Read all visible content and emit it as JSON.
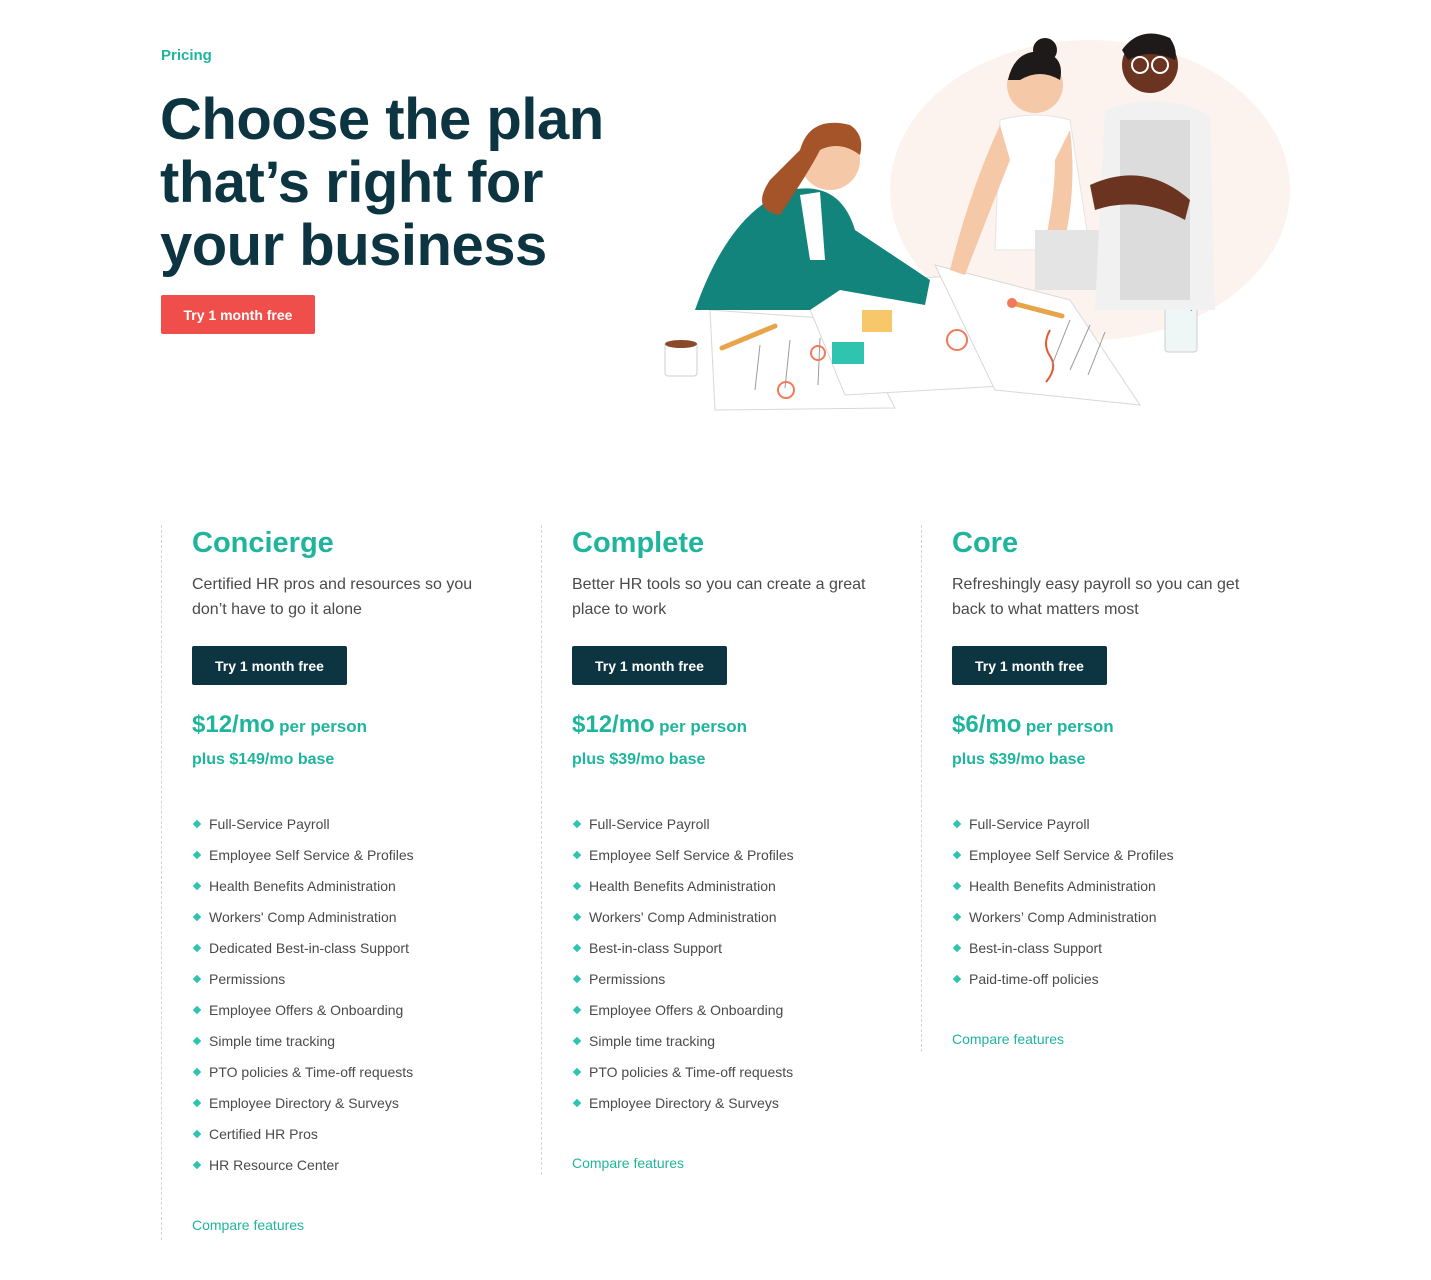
{
  "hero": {
    "eyebrow": "Pricing",
    "headline": "Choose the plan that’s right for your business",
    "cta_label": "Try 1 month free"
  },
  "plans": [
    {
      "name": "Concierge",
      "description": "Certified HR pros and resources so you don’t have to go it alone",
      "cta_label": "Try 1 month free",
      "price": "$12/mo",
      "price_unit": "per person",
      "base": "plus $149/mo base",
      "features": [
        "Full-Service Payroll",
        "Employee Self Service & Profiles",
        "Health Benefits Administration",
        "Workers' Comp Administration",
        "Dedicated Best-in-class Support",
        "Permissions",
        "Employee Offers & Onboarding",
        "Simple time tracking",
        "PTO policies & Time-off requests",
        "Employee Directory & Surveys",
        "Certified HR Pros",
        "HR Resource Center"
      ],
      "compare_label": "Compare features"
    },
    {
      "name": "Complete",
      "description": "Better HR tools so you can create a great place to work",
      "cta_label": "Try 1 month free",
      "price": "$12/mo",
      "price_unit": "per person",
      "base": "plus $39/mo base",
      "features": [
        "Full-Service Payroll",
        "Employee Self Service & Profiles",
        "Health Benefits Administration",
        "Workers' Comp Administration",
        "Best-in-class Support",
        "Permissions",
        "Employee Offers & Onboarding",
        "Simple time tracking",
        "PTO policies & Time-off requests",
        "Employee Directory & Surveys"
      ],
      "compare_label": "Compare features"
    },
    {
      "name": "Core",
      "description": "Refreshingly easy payroll so you can get back to what matters most",
      "cta_label": "Try 1 month free",
      "price": "$6/mo",
      "price_unit": "per person",
      "base": "plus $39/mo base",
      "features": [
        "Full-Service Payroll",
        "Employee Self Service & Profiles",
        "Health Benefits Administration",
        "Workers’ Comp Administration",
        "Best-in-class Support",
        "Paid-time-off policies"
      ],
      "compare_label": "Compare features"
    }
  ],
  "colors": {
    "brand_teal": "#1fb59d",
    "navy": "#0c3541",
    "coral": "#f04e4b"
  }
}
